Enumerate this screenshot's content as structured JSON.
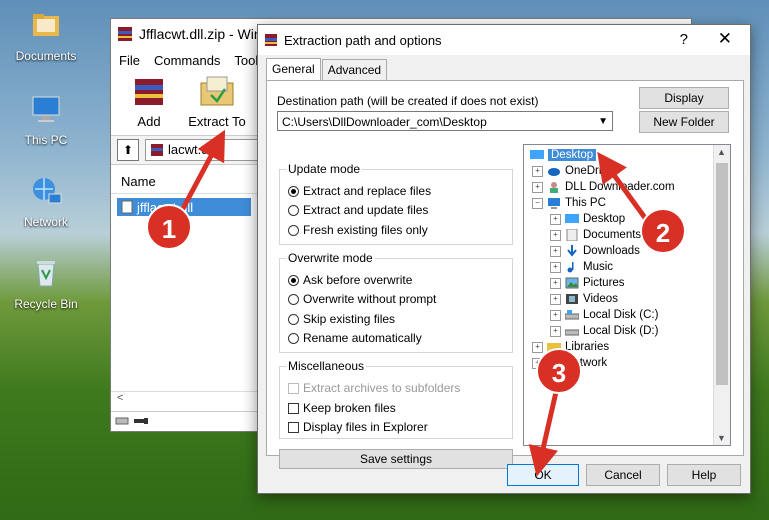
{
  "desktop": {
    "icons": [
      {
        "label": "Documents"
      },
      {
        "label": "This PC"
      },
      {
        "label": "Network"
      },
      {
        "label": "Recycle Bin"
      }
    ]
  },
  "winrar": {
    "title": "Jfflacwt.dll.zip - WinR",
    "menu": [
      "File",
      "Commands",
      "Tools"
    ],
    "toolbar": [
      "Add",
      "Extract To",
      "T"
    ],
    "path": "lacwt.dll.z",
    "column_name": "Name",
    "file": "jfflacwt.dll"
  },
  "dialog": {
    "title": "Extraction path and options",
    "help": "?",
    "close": "✕",
    "tabs": [
      "General",
      "Advanced"
    ],
    "dest_label": "Destination path (will be created if does not exist)",
    "dest_value": "C:\\Users\\DllDownloader_com\\Desktop",
    "display_btn": "Display",
    "new_folder_btn": "New Folder",
    "update_mode": {
      "title": "Update mode",
      "options": [
        "Extract and replace files",
        "Extract and update files",
        "Fresh existing files only"
      ],
      "selected": 0
    },
    "overwrite_mode": {
      "title": "Overwrite mode",
      "options": [
        "Ask before overwrite",
        "Overwrite without prompt",
        "Skip existing files",
        "Rename automatically"
      ],
      "selected": 0
    },
    "misc": {
      "title": "Miscellaneous",
      "options": [
        "Extract archives to subfolders",
        "Keep broken files",
        "Display files in Explorer"
      ]
    },
    "save_settings": "Save settings",
    "tree": [
      {
        "label": "Desktop",
        "selected": true
      },
      {
        "label": "OneDrive"
      },
      {
        "label": "DLL Downloader.com"
      },
      {
        "label": "This PC"
      },
      {
        "label": "Desktop"
      },
      {
        "label": "Documents"
      },
      {
        "label": "Downloads"
      },
      {
        "label": "Music"
      },
      {
        "label": "Pictures"
      },
      {
        "label": "Videos"
      },
      {
        "label": "Local Disk (C:)"
      },
      {
        "label": "Local Disk (D:)"
      },
      {
        "label": "Libraries"
      },
      {
        "label": "Network"
      }
    ],
    "ok": "OK",
    "cancel": "Cancel",
    "help_btn": "Help"
  },
  "annotations": [
    "1",
    "2",
    "3"
  ],
  "colors": {
    "annotation": "#d93025",
    "selection": "#3f8cd9",
    "ok_border": "#0078d7"
  }
}
